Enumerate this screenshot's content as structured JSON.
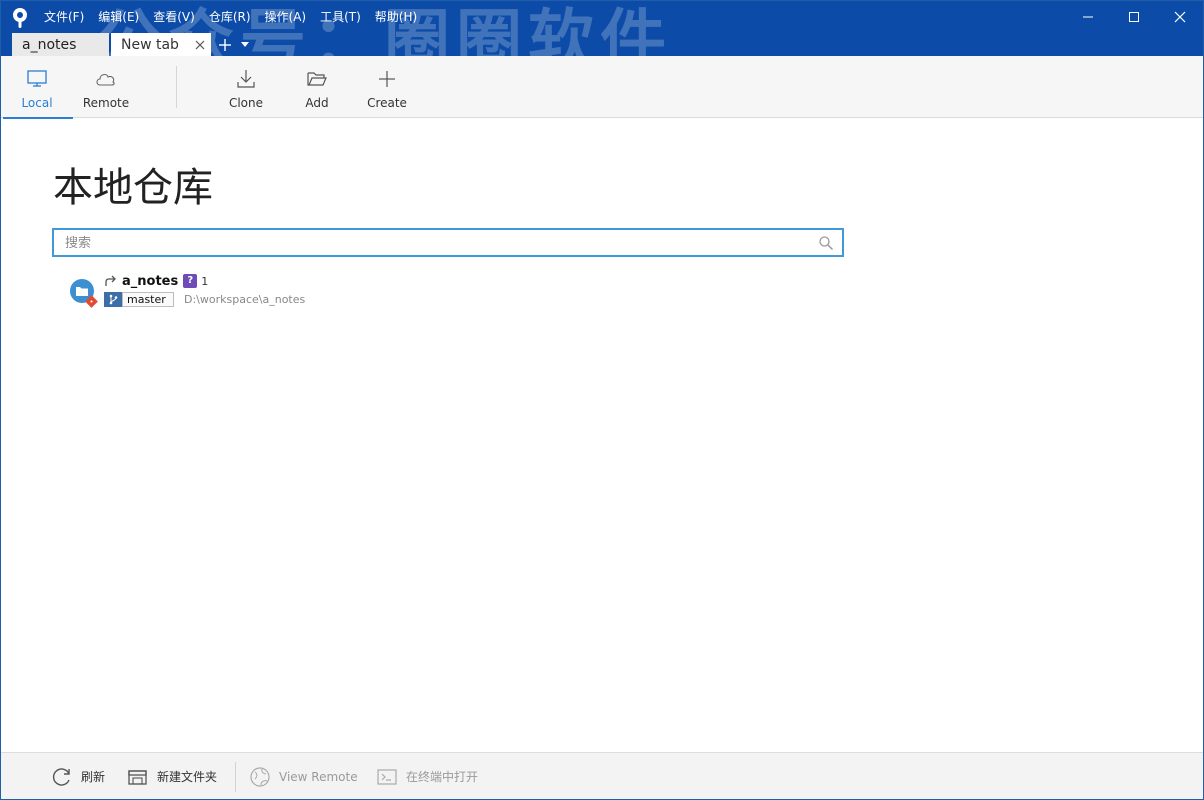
{
  "menu": [
    "文件(F)",
    "编辑(E)",
    "查看(V)",
    "仓库(R)",
    "操作(A)",
    "工具(T)",
    "帮助(H)"
  ],
  "tabs": {
    "first": "a_notes",
    "active": "New tab"
  },
  "watermark": "公众号：圈圈软件",
  "toolbar": {
    "local": "Local",
    "remote": "Remote",
    "clone": "Clone",
    "add": "Add",
    "create": "Create"
  },
  "page_title": "本地仓库",
  "search": {
    "placeholder": "搜索",
    "value": ""
  },
  "repo": {
    "name": "a_notes",
    "badge": "?",
    "count": "1",
    "branch": "master",
    "path": "D:\\workspace\\a_notes"
  },
  "bottom": {
    "refresh": "刷新",
    "new_folder": "新建文件夹",
    "view_remote": "View Remote",
    "open_terminal": "在终端中打开"
  },
  "colors": {
    "titlebar": "#0c4ca8",
    "accent": "#2a7fd4",
    "search_border": "#3f9ad7",
    "badge": "#6f4bb7"
  }
}
